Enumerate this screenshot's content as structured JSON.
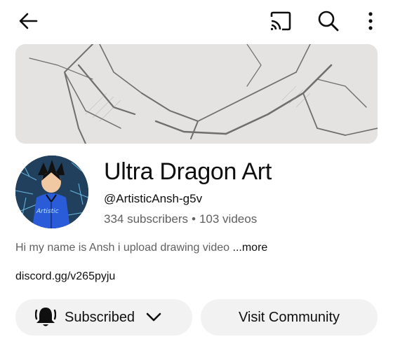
{
  "channel": {
    "name": "Ultra Dragon Art",
    "handle": "@ArtisticAnsh-g5v",
    "subscribers": "334 subscribers",
    "separator": "•",
    "videos": "103 videos",
    "description": "Hi my name is Ansh i upload  drawing video ",
    "more_label": "...more",
    "link": "discord.gg/v265pyju"
  },
  "actions": {
    "subscribed_label": "Subscribed",
    "community_label": "Visit Community"
  },
  "icons": {
    "back": "arrow-left-icon",
    "cast": "cast-icon",
    "search": "search-icon",
    "more": "more-vertical-icon",
    "bell": "bell-icon",
    "chevron": "chevron-down-icon"
  },
  "colors": {
    "text_primary": "#0f0f0f",
    "text_secondary": "#606060",
    "pill_bg": "#f2f2f2"
  }
}
